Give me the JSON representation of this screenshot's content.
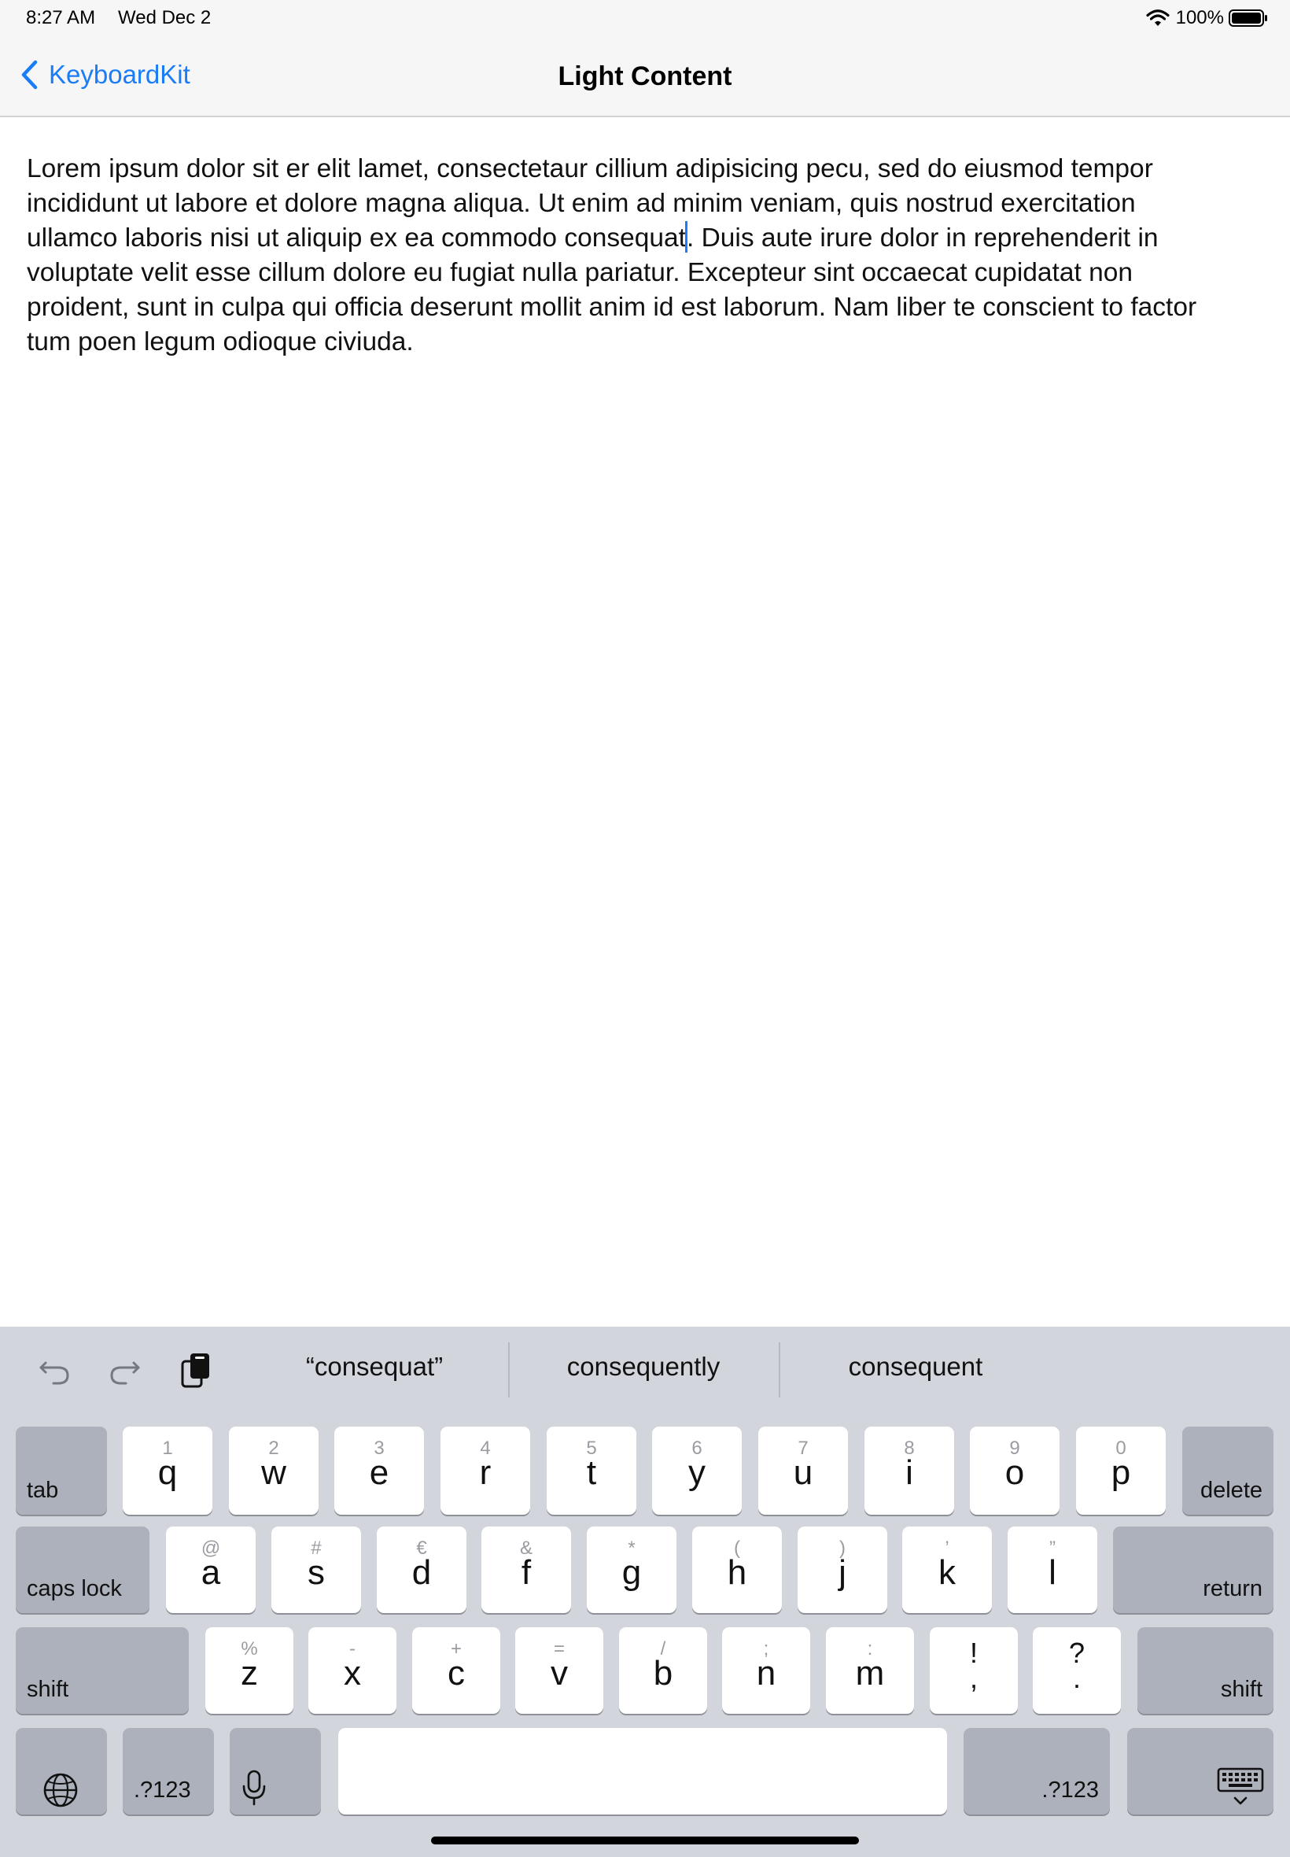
{
  "status": {
    "time": "8:27 AM",
    "date": "Wed Dec 2",
    "battery": "100%"
  },
  "nav": {
    "back_label": "KeyboardKit",
    "title": "Light Content"
  },
  "text": {
    "lines": [
      "Lorem ipsum dolor sit er elit lamet, consectetaur cillium adipisicing pecu, sed do eiusmod tempor",
      "incididunt ut labore et dolore magna aliqua. Ut enim ad minim veniam, quis nostrud exercitation",
      "ullamco laboris nisi ut aliquip ex ea commodo consequat",
      ". Duis aute irure dolor in reprehenderit in",
      "voluptate velit esse cillum dolore eu fugiat nulla pariatur. Excepteur sint occaecat cupidatat non",
      "proident, sunt in culpa qui officia deserunt mollit anim id est laborum. Nam liber te conscient to factor",
      "tum poen legum odioque civiuda."
    ]
  },
  "keyboard": {
    "suggestions": [
      "“consequat”",
      "consequently",
      "consequent"
    ],
    "row1": {
      "tab": "tab",
      "delete": "delete",
      "keys": [
        {
          "hint": "1",
          "letter": "q"
        },
        {
          "hint": "2",
          "letter": "w"
        },
        {
          "hint": "3",
          "letter": "e"
        },
        {
          "hint": "4",
          "letter": "r"
        },
        {
          "hint": "5",
          "letter": "t"
        },
        {
          "hint": "6",
          "letter": "y"
        },
        {
          "hint": "7",
          "letter": "u"
        },
        {
          "hint": "8",
          "letter": "i"
        },
        {
          "hint": "9",
          "letter": "o"
        },
        {
          "hint": "0",
          "letter": "p"
        }
      ]
    },
    "row2": {
      "caps": "caps lock",
      "return": "return",
      "keys": [
        {
          "hint": "@",
          "letter": "a"
        },
        {
          "hint": "#",
          "letter": "s"
        },
        {
          "hint": "€",
          "letter": "d"
        },
        {
          "hint": "&",
          "letter": "f"
        },
        {
          "hint": "*",
          "letter": "g"
        },
        {
          "hint": "(",
          "letter": "h"
        },
        {
          "hint": ")",
          "letter": "j"
        },
        {
          "hint": "’",
          "letter": "k"
        },
        {
          "hint": "”",
          "letter": "l"
        }
      ]
    },
    "row3": {
      "shift": "shift",
      "keys": [
        {
          "hint": "%",
          "letter": "z"
        },
        {
          "hint": "-",
          "letter": "x"
        },
        {
          "hint": "+",
          "letter": "c"
        },
        {
          "hint": "=",
          "letter": "v"
        },
        {
          "hint": "/",
          "letter": "b"
        },
        {
          "hint": ";",
          "letter": "n"
        },
        {
          "hint": ":",
          "letter": "m"
        }
      ],
      "punct": [
        {
          "top": "!",
          "bottom": ","
        },
        {
          "top": "?",
          "bottom": "."
        }
      ]
    },
    "row4": {
      "numbers": ".?123"
    },
    "icons": [
      "undo-icon",
      "redo-icon",
      "clipboard-icon",
      "globe-icon",
      "microphone-icon",
      "keyboard-dismiss-icon"
    ]
  },
  "colors": {
    "accent": "#1a7cf6",
    "keyboard_bg": "#d3d5dc",
    "dark_key": "#acb1bc"
  }
}
